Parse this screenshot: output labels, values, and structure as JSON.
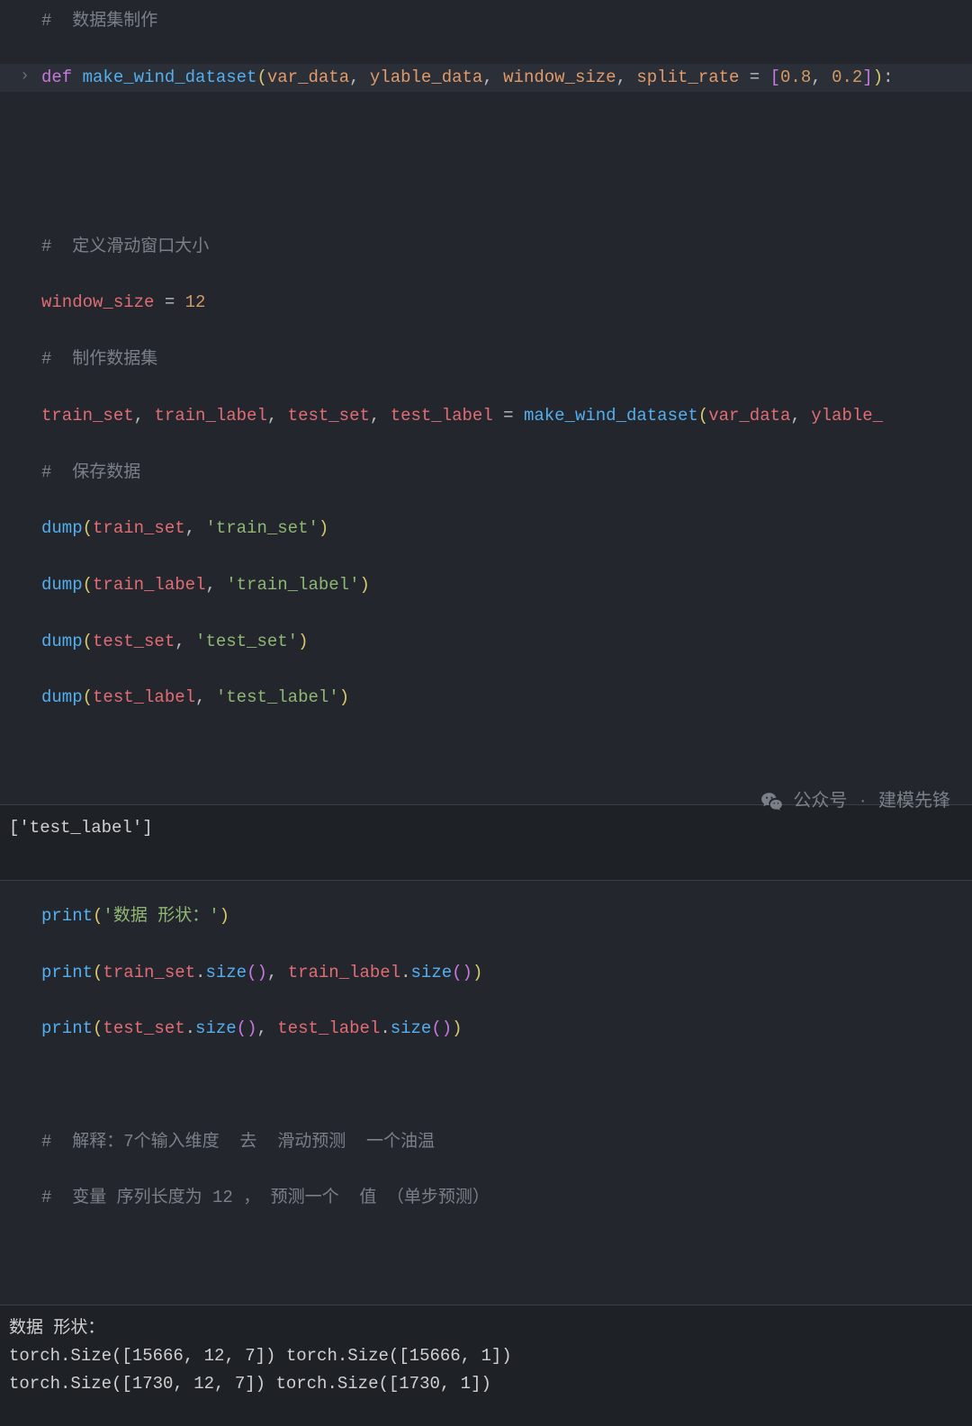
{
  "cell1": {
    "comment1": "#  数据集制作",
    "def_kw": "def",
    "fn_name": "make_wind_dataset",
    "param_var_data": "var_data",
    "param_ylable_data": "ylable_data",
    "param_window_size": "window_size",
    "param_split_rate": "split_rate",
    "eq": " = ",
    "lb": "[",
    "num08": "0.8",
    "comma": ", ",
    "num02": "0.2",
    "rb": "]",
    "rp": ")",
    "colon": ":",
    "comment2": "#  定义滑动窗口大小",
    "ws_var": "window_size",
    "ws_val": "12",
    "comment3": "#  制作数据集",
    "train_set": "train_set",
    "train_label": "train_label",
    "test_set": "test_set",
    "test_label": "test_label",
    "call_fn": "make_wind_dataset",
    "arg_var_data": "var_data",
    "arg_ylable_": "ylable_",
    "comment4": "#  保存数据",
    "dump": "dump",
    "str_train_set": "'train_set'",
    "str_train_label": "'train_label'",
    "str_test_set": "'test_set'",
    "str_test_label": "'test_label'"
  },
  "output1": "['test_label']",
  "cell2": {
    "print": "print",
    "str_shape": "'数据 形状：'",
    "size": "size",
    "train_set": "train_set",
    "train_label": "train_label",
    "test_set": "test_set",
    "test_label": "test_label",
    "comment5": "#  解释：7个输入维度  去  滑动预测  一个油温",
    "comment6": "#  变量 序列长度为 12 ， 预测一个  值 （单步预测）"
  },
  "output2": {
    "line1": "数据 形状：",
    "line2": "torch.Size([15666, 12, 7]) torch.Size([15666, 1])",
    "line3": "torch.Size([1730, 12, 7]) torch.Size([1730, 1])"
  },
  "watermark": {
    "prefix": "公众号",
    "dot": "·",
    "name": "建模先锋"
  }
}
